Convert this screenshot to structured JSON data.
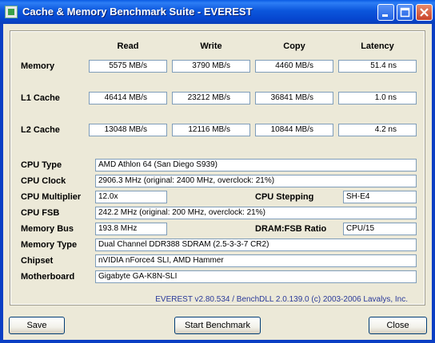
{
  "window": {
    "title": "Cache & Memory Benchmark Suite - EVEREST"
  },
  "columns": [
    "Read",
    "Write",
    "Copy",
    "Latency"
  ],
  "rows": [
    {
      "label": "Memory",
      "read": "5575 MB/s",
      "write": "3790 MB/s",
      "copy": "4460 MB/s",
      "latency": "51.4 ns"
    },
    {
      "label": "L1 Cache",
      "read": "46414 MB/s",
      "write": "23212 MB/s",
      "copy": "36841 MB/s",
      "latency": "1.0 ns"
    },
    {
      "label": "L2 Cache",
      "read": "13048 MB/s",
      "write": "12116 MB/s",
      "copy": "10844 MB/s",
      "latency": "4.2 ns"
    }
  ],
  "info": {
    "cpu_type": {
      "label": "CPU Type",
      "value": "AMD Athlon 64  (San Diego S939)"
    },
    "cpu_clock": {
      "label": "CPU Clock",
      "value": "2906.3 MHz  (original: 2400 MHz, overclock: 21%)"
    },
    "cpu_multiplier": {
      "label": "CPU Multiplier",
      "value": "12.0x"
    },
    "cpu_stepping": {
      "label": "CPU Stepping",
      "value": "SH-E4"
    },
    "cpu_fsb": {
      "label": "CPU FSB",
      "value": "242.2 MHz  (original: 200 MHz, overclock: 21%)"
    },
    "memory_bus": {
      "label": "Memory Bus",
      "value": "193.8 MHz"
    },
    "dram_fsb_ratio": {
      "label": "DRAM:FSB Ratio",
      "value": "CPU/15"
    },
    "memory_type": {
      "label": "Memory Type",
      "value": "Dual Channel DDR388 SDRAM  (2.5-3-3-7 CR2)"
    },
    "chipset": {
      "label": "Chipset",
      "value": "nVIDIA nForce4 SLI, AMD Hammer"
    },
    "motherboard": {
      "label": "Motherboard",
      "value": "Gigabyte GA-K8N-SLI"
    }
  },
  "footer": {
    "version": "EVEREST  v2.80.534 / BenchDLL 2.0.139.0  (c) 2003-2006 Lavalys, Inc."
  },
  "buttons": {
    "save": "Save",
    "start": "Start Benchmark",
    "close": "Close"
  },
  "icons": {
    "app": "everest-app-icon",
    "minimize": "minimize-icon",
    "maximize": "maximize-icon",
    "close": "close-icon"
  }
}
